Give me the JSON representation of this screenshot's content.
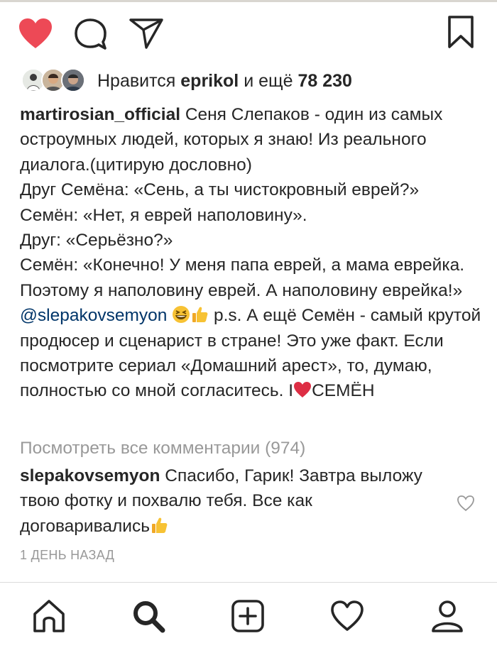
{
  "post": {
    "actions": {
      "like": "heart-filled-icon",
      "comment": "comment-icon",
      "share": "send-icon",
      "save": "bookmark-icon"
    },
    "likes": {
      "prefix": "Нравится ",
      "user": "eprikol",
      "middle": " и ещё ",
      "count": "78 230"
    },
    "caption": {
      "author": "martirosian_official",
      "text1": " Сеня Слепаков - один из самых остроумных людей, которых я знаю! Из реального диалога.(цитирую дословно)\nДруг Семёна: «Сень, а ты чистокровный еврей?»\nСемён: «Нет, я еврей наполовину».\nДруг: «Серьёзно?»\nСемён: «Конечно! У меня папа еврей, а мама еврейка. Поэтому я наполовину еврей. А наполовину еврейка!» ",
      "mention": "@slepakovsemyon",
      "text2": " p.s. А ещё Семён - самый крутой продюсер и сценарист в стране! Это уже факт. Если посмотрите сериал «Домашний арест», то, думаю, полностью со мной согласитесь. I",
      "text3": "СЕМЁН"
    },
    "view_all_comments": "Посмотреть все комментарии (974)",
    "comment": {
      "author": "slepakovsemyon",
      "text": " Спасибо, Гарик! Завтра выложу твою фотку и похвалю тебя. Все как договаривались"
    },
    "timestamp": "1 ДЕНЬ НАЗАД"
  },
  "navbar": [
    "home-icon",
    "search-icon",
    "add-post-icon",
    "activity-icon",
    "profile-icon"
  ],
  "colors": {
    "like_red": "#ed4956",
    "text": "#262626",
    "muted": "#999999",
    "mention": "#003569",
    "emoji_yellow": "#f7c234"
  }
}
